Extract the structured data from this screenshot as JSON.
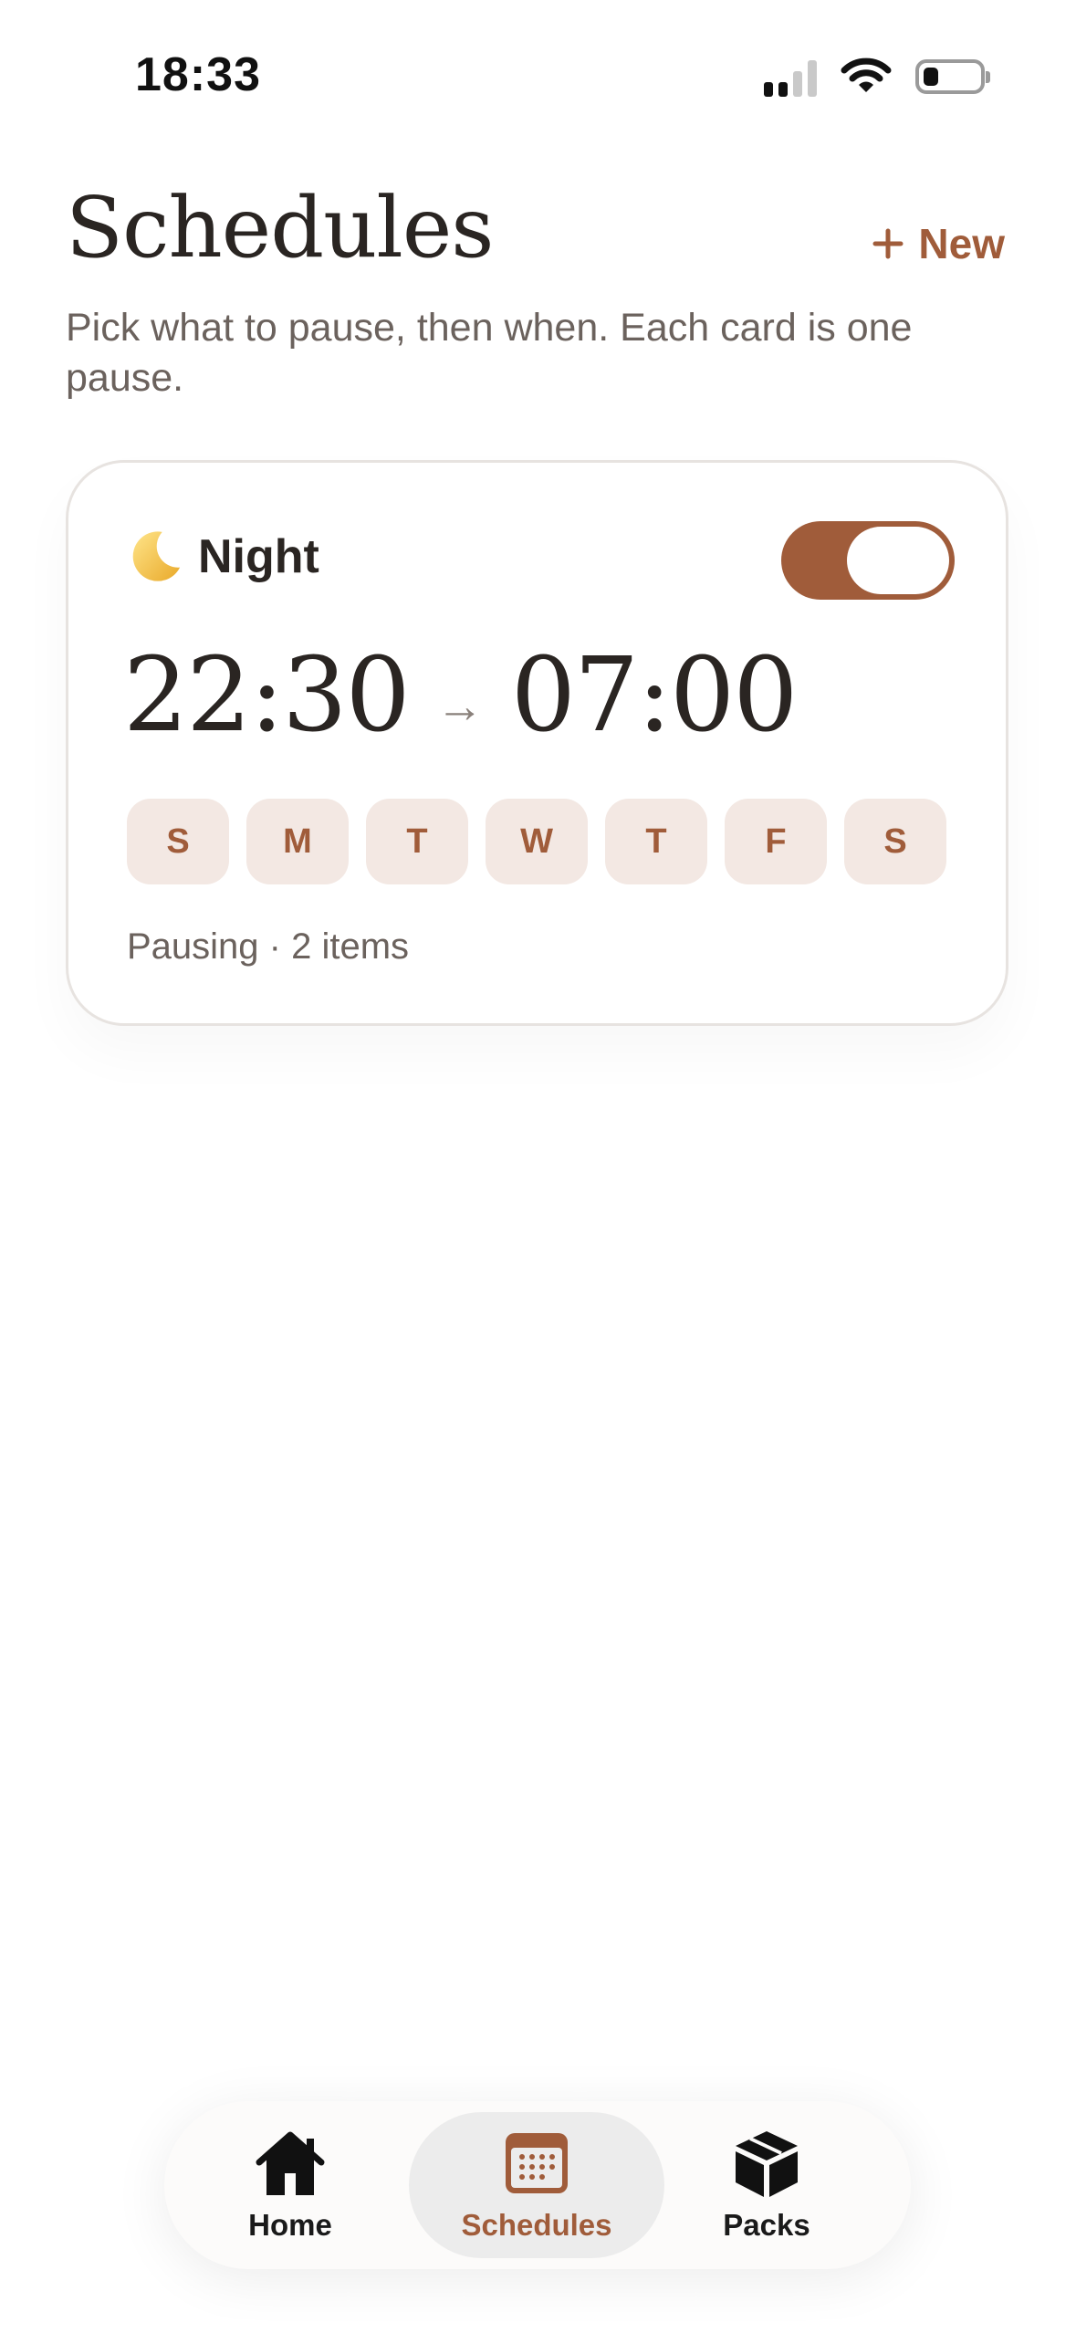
{
  "status_bar": {
    "time": "18:33"
  },
  "header": {
    "title": "Schedules",
    "new_button_icon": "plus-icon",
    "new_button_label": "New",
    "subtitle": "Pick what to pause, then when. Each card is one pause."
  },
  "schedule_card": {
    "icon": "crescent-moon",
    "name": "Night",
    "enabled": true,
    "start_time": "22:30",
    "arrow": "→",
    "end_time": "07:00",
    "days": [
      "S",
      "M",
      "T",
      "W",
      "T",
      "F",
      "S"
    ],
    "summary": "Pausing · 2 items"
  },
  "tab_bar": {
    "tabs": [
      {
        "label": "Home",
        "icon": "house-icon",
        "active": false
      },
      {
        "label": "Schedules",
        "icon": "calendar-icon",
        "active": true
      },
      {
        "label": "Packs",
        "icon": "box-icon",
        "active": false
      }
    ]
  },
  "colors": {
    "accent": "#a05c3a",
    "day_chip_bg": "#f3e8e3",
    "text_primary": "#2a2522",
    "text_secondary": "#6b625d"
  }
}
